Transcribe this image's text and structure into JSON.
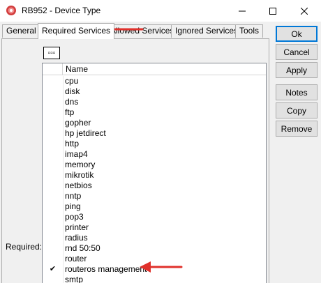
{
  "window": {
    "title": "RB952 - Device Type",
    "controls": {
      "minimize": "—",
      "maximize": "☐",
      "close": "✕"
    }
  },
  "tabs": [
    {
      "label": "General",
      "active": false
    },
    {
      "label": "Required Services",
      "active": true
    },
    {
      "label": "Allowed Services",
      "active": false
    },
    {
      "label": "Ignored Services",
      "active": false
    },
    {
      "label": "Tools",
      "active": false
    }
  ],
  "column_button_label": "▫▫▫",
  "required_label": "Required:",
  "list": {
    "column_header": "Name",
    "rows": [
      {
        "name": "cpu",
        "checked": false
      },
      {
        "name": "disk",
        "checked": false
      },
      {
        "name": "dns",
        "checked": false
      },
      {
        "name": "ftp",
        "checked": false
      },
      {
        "name": "gopher",
        "checked": false
      },
      {
        "name": "hp jetdirect",
        "checked": false
      },
      {
        "name": "http",
        "checked": false
      },
      {
        "name": "imap4",
        "checked": false
      },
      {
        "name": "memory",
        "checked": false
      },
      {
        "name": "mikrotik",
        "checked": false
      },
      {
        "name": "netbios",
        "checked": false
      },
      {
        "name": "nntp",
        "checked": false
      },
      {
        "name": "ping",
        "checked": false
      },
      {
        "name": "pop3",
        "checked": false
      },
      {
        "name": "printer",
        "checked": false
      },
      {
        "name": "radius",
        "checked": false
      },
      {
        "name": "rnd 50:50",
        "checked": false
      },
      {
        "name": "router",
        "checked": false
      },
      {
        "name": "routeros management",
        "checked": true
      },
      {
        "name": "smtp",
        "checked": false
      }
    ]
  },
  "side_buttons": {
    "ok": "Ok",
    "cancel": "Cancel",
    "apply": "Apply",
    "notes": "Notes",
    "copy": "Copy",
    "remove": "Remove"
  },
  "check_glyph": "✔",
  "colors": {
    "accent_arrow": "#e0312b",
    "default_button_border": "#0078d7"
  }
}
